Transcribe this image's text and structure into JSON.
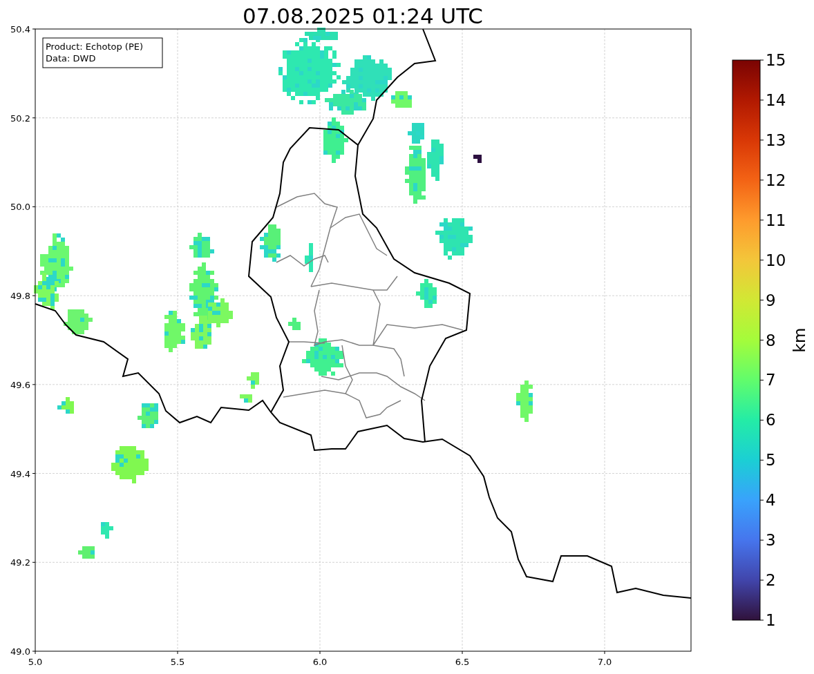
{
  "title": "07.08.2025 01:24 UTC",
  "legend": [
    "Product: Echotop (PE)",
    "Data: DWD"
  ],
  "x_axis": {
    "ticks": [
      "5.0",
      "5.5",
      "6.0",
      "6.5",
      "7.0"
    ]
  },
  "y_axis": {
    "ticks": [
      "50.4",
      "50.2",
      "50.0",
      "49.8",
      "49.6",
      "49.4",
      "49.2",
      "49.0"
    ]
  },
  "colorbar": {
    "label": "km",
    "ticks": [
      "15",
      "14",
      "13",
      "12",
      "11",
      "10",
      "9",
      "8",
      "7",
      "6",
      "5",
      "4",
      "3",
      "2",
      "1"
    ]
  }
}
